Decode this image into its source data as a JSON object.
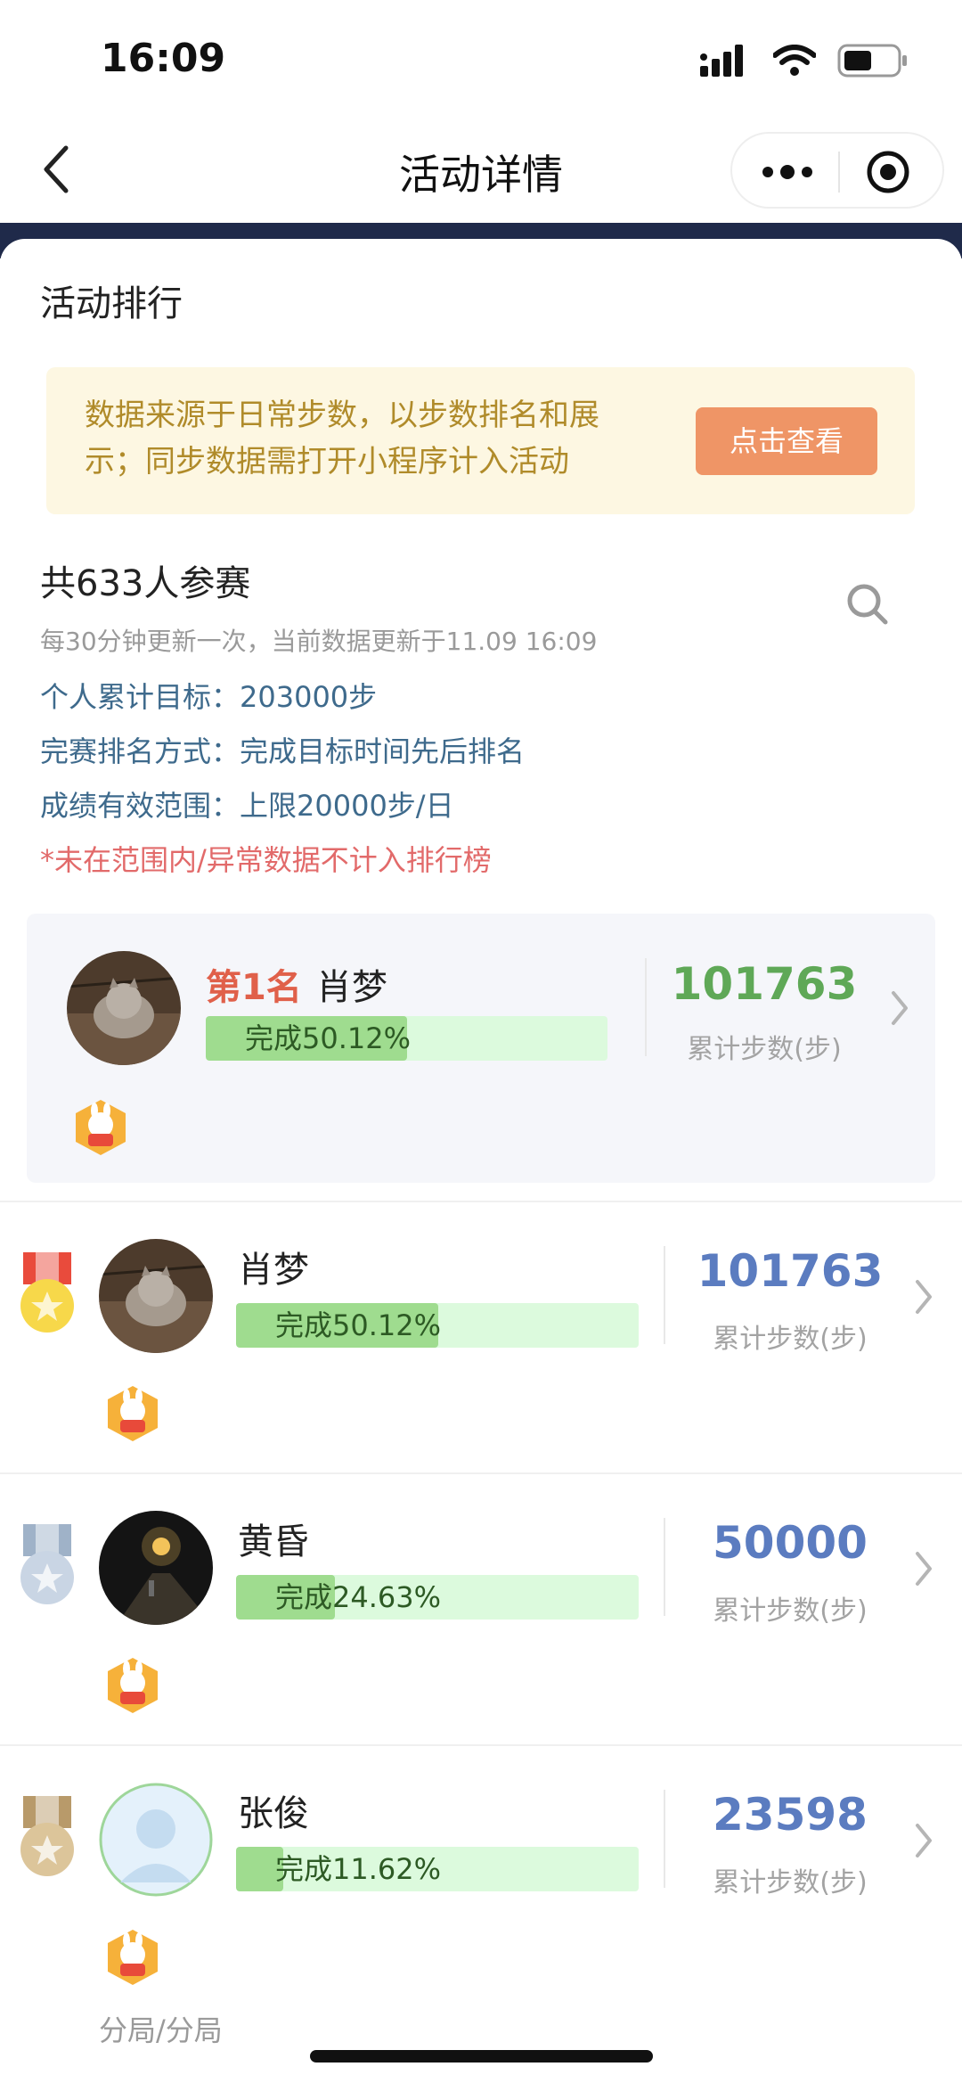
{
  "status_bar": {
    "time": "16:09"
  },
  "nav": {
    "title": "活动详情"
  },
  "section": {
    "title": "活动排行"
  },
  "notice": {
    "text": "数据来源于日常步数，以步数排名和展示；同步数据需打开小程序计入活动",
    "button_label": "点击查看"
  },
  "summary": {
    "participants": "共633人参赛",
    "update_info": "每30分钟更新一次，当前数据更新于11.09 16:09",
    "target": "个人累计目标：203000步",
    "ranking_method": "完赛排名方式：完成目标时间先后排名",
    "valid_range": "成绩有效范围：上限20000步/日",
    "warning": "*未在范围内/异常数据不计入排行榜"
  },
  "my_rank": {
    "rank_label": "第1名",
    "name": "肖梦",
    "progress_text": "完成50.12%",
    "progress": 0.5012,
    "steps": "101763",
    "steps_label": "累计步数(步)"
  },
  "leaderboard": [
    {
      "name": "肖梦",
      "progress_text": "完成50.12%",
      "progress": 0.5012,
      "steps": "101763",
      "steps_label": "累计步数(步)",
      "medal": "gold"
    },
    {
      "name": "黄昏",
      "progress_text": "完成24.63%",
      "progress": 0.2463,
      "steps": "50000",
      "steps_label": "累计步数(步)",
      "medal": "silver"
    },
    {
      "name": "张俊",
      "progress_text": "完成11.62%",
      "progress": 0.1162,
      "steps": "23598",
      "steps_label": "累计步数(步)",
      "medal": "bronze",
      "department": "分局/分局"
    }
  ],
  "colors": {
    "my_steps": "#5fa857",
    "steps": "#5b7cc0",
    "accent_button": "#ef9566",
    "notice_bg": "#fdf7e2",
    "warning": "#e26a6a"
  }
}
